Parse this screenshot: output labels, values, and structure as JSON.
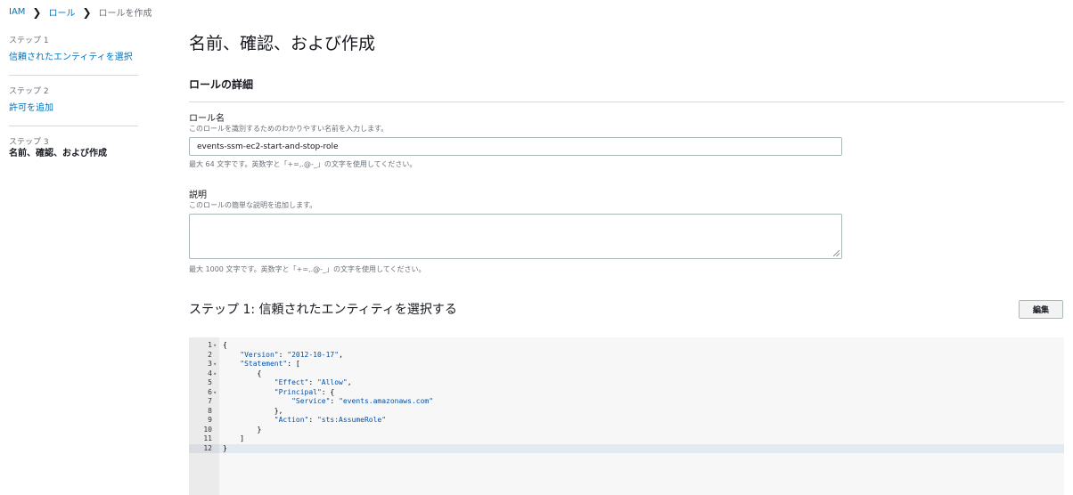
{
  "breadcrumb": {
    "items": [
      "IAM",
      "ロール",
      "ロールを作成"
    ]
  },
  "sidebar": {
    "steps": [
      {
        "num": "ステップ 1",
        "label": "信頼されたエンティティを選択"
      },
      {
        "num": "ステップ 2",
        "label": "許可を追加"
      },
      {
        "num": "ステップ 3",
        "label": "名前、確認、および作成"
      }
    ]
  },
  "main": {
    "title": "名前、確認、および作成",
    "section_title": "ロールの詳細",
    "role_name": {
      "label": "ロール名",
      "desc": "このロールを識別するためのわかりやすい名前を入力します。",
      "value": "events-ssm-ec2-start-and-stop-role",
      "hint": "最大 64 文字です。英数字と「+=,.@-_」の文字を使用してください。"
    },
    "description": {
      "label": "説明",
      "desc": "このロールの簡単な説明を追加します。",
      "value": "",
      "hint": "最大 1000 文字です。英数字と「+=,.@-_」の文字を使用してください。"
    },
    "step1": {
      "title": "ステップ 1: 信頼されたエンティティを選択する",
      "edit_label": "編集"
    }
  },
  "editor": {
    "lines": [
      {
        "n": "1",
        "fold": true,
        "text": "{"
      },
      {
        "n": "2",
        "fold": false,
        "text": "    \"Version\": \"2012-10-17\","
      },
      {
        "n": "3",
        "fold": true,
        "text": "    \"Statement\": ["
      },
      {
        "n": "4",
        "fold": true,
        "text": "        {"
      },
      {
        "n": "5",
        "fold": false,
        "text": "            \"Effect\": \"Allow\","
      },
      {
        "n": "6",
        "fold": true,
        "text": "            \"Principal\": {"
      },
      {
        "n": "7",
        "fold": false,
        "text": "                \"Service\": \"events.amazonaws.com\""
      },
      {
        "n": "8",
        "fold": false,
        "text": "            },"
      },
      {
        "n": "9",
        "fold": false,
        "text": "            \"Action\": \"sts:AssumeRole\""
      },
      {
        "n": "10",
        "fold": false,
        "text": "        }"
      },
      {
        "n": "11",
        "fold": false,
        "text": "    ]"
      },
      {
        "n": "12",
        "fold": false,
        "text": "}"
      }
    ],
    "active_line": 12
  }
}
